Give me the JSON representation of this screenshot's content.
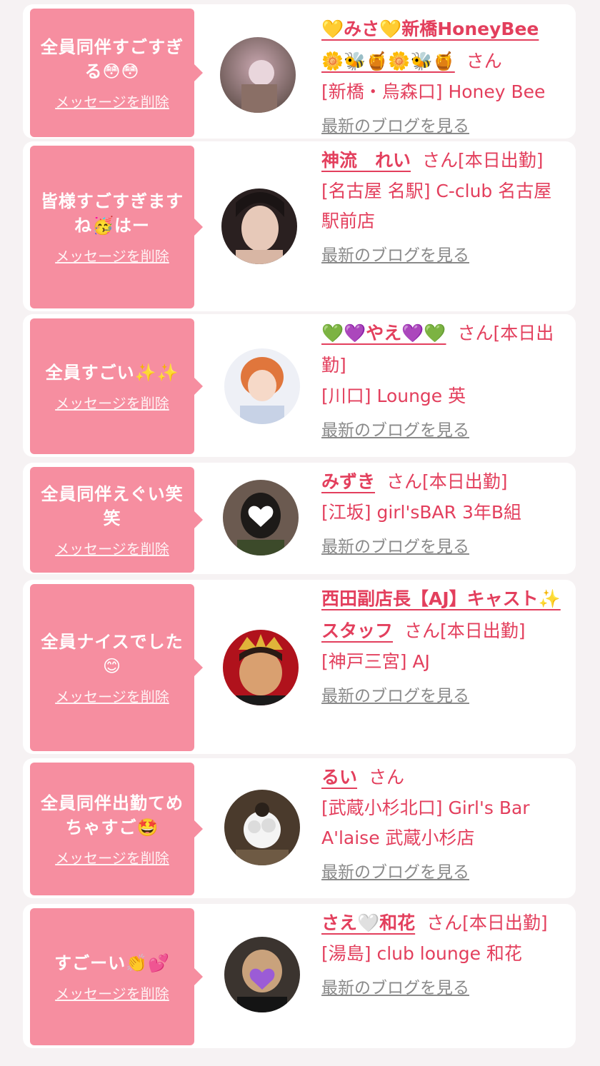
{
  "items": [
    {
      "message": "全員同伴すごすぎる😳😳",
      "delete_label": "メッセージを削除",
      "name": "💛みさ💛新橋HoneyBee 🌼🐝🍯🌼🐝🍯",
      "suffix": "さん",
      "shop": "[新橋・烏森口] Honey Bee",
      "blog_label": "最新のブログを見る",
      "avatar_icon": "user-photo",
      "avatar_colors": [
        "#5a4a44",
        "#c9a7b0"
      ]
    },
    {
      "message": "皆様すごすぎますね🥳はー",
      "delete_label": "メッセージを削除",
      "name": "神流　れい",
      "suffix": "さん[本日出勤]",
      "shop": "[名古屋 名駅] C-club 名古屋駅前店",
      "blog_label": "最新のブログを見る",
      "avatar_icon": "user-photo",
      "avatar_colors": [
        "#2a2020",
        "#e7c9b9"
      ]
    },
    {
      "message": "全員すごい✨✨",
      "delete_label": "メッセージを削除",
      "name": "💚💜やえ💜💚",
      "suffix": "さん[本日出勤]",
      "shop": "[川口] Lounge 英",
      "blog_label": "最新のブログを見る",
      "avatar_icon": "user-photo",
      "avatar_colors": [
        "#e0763c",
        "#eef0f6"
      ]
    },
    {
      "message": "全員同伴えぐい笑笑",
      "delete_label": "メッセージを削除",
      "name": "みずき",
      "suffix": "さん[本日出勤]",
      "shop": "[江坂] girl'sBAR 3年B組",
      "blog_label": "最新のブログを見る",
      "avatar_icon": "user-photo",
      "avatar_colors": [
        "#6b5a50",
        "#ffffff"
      ]
    },
    {
      "message": "全員ナイスでした😊",
      "delete_label": "メッセージを削除",
      "name": "西田副店長【AJ】キャスト✨スタッフ",
      "suffix": "さん[本日出勤]",
      "shop": "[神戸三宮] AJ",
      "blog_label": "最新のブログを見る",
      "avatar_icon": "user-photo",
      "avatar_colors": [
        "#b0121c",
        "#d9a070"
      ]
    },
    {
      "message": "全員同伴出勤てめちゃすご🤩",
      "delete_label": "メッセージを削除",
      "name": "るい",
      "suffix": "さん",
      "shop": "[武蔵小杉北口] Girl's Bar A'laise 武蔵小杉店",
      "blog_label": "最新のブログを見る",
      "avatar_icon": "user-photo",
      "avatar_colors": [
        "#4a3a2c",
        "#f4f4f4"
      ]
    },
    {
      "message": "すごーい👏💕",
      "delete_label": "メッセージを削除",
      "name": "さえ🤍和花",
      "suffix": "さん[本日出勤]",
      "shop": "[湯島] club lounge 和花",
      "blog_label": "最新のブログを見る",
      "avatar_icon": "user-photo",
      "avatar_colors": [
        "#3b342f",
        "#9b5cd6"
      ]
    }
  ]
}
